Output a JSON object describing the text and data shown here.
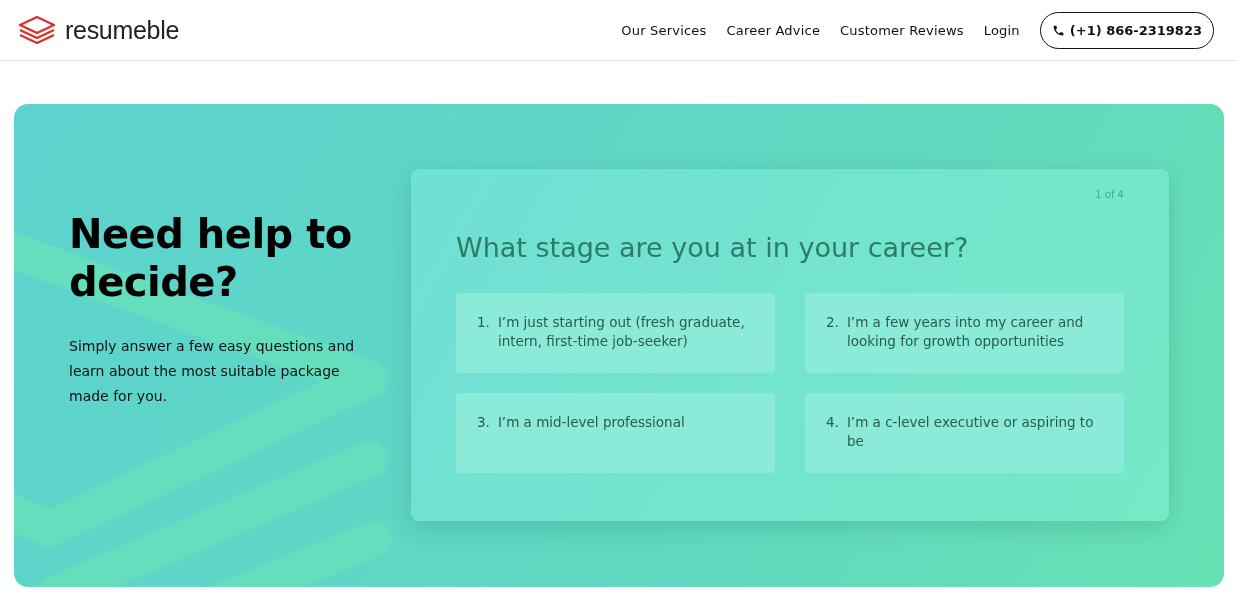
{
  "header": {
    "logo": "resumeble",
    "nav": [
      "Our Services",
      "Career Advice",
      "Customer Reviews",
      "Login"
    ],
    "phone": "(+1) 866-2319823"
  },
  "hero": {
    "heading": "Need help to decide?",
    "text": "Simply answer a few easy questions and learn about the most suitable package made for you.",
    "quiz": {
      "progress": "1 of 4",
      "question": "What stage are you at in your career?",
      "options": [
        {
          "number": "1.",
          "text": "I’m just starting out (fresh graduate, intern, first-time job-seeker)"
        },
        {
          "number": "2.",
          "text": "I’m a few years into my career and looking for growth opportunities"
        },
        {
          "number": "3.",
          "text": "I’m a mid-level professional"
        },
        {
          "number": "4.",
          "text": "I’m a c-level executive or aspiring to be"
        }
      ]
    }
  }
}
